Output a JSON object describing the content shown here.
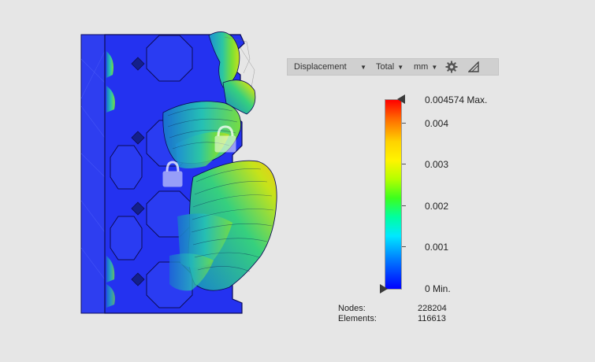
{
  "toolbar": {
    "result_type": "Displacement",
    "component": "Total",
    "unit": "mm",
    "settings_icon": "gear-icon",
    "legend_toggle_icon": "triangle-icon"
  },
  "legend": {
    "max_label": "0.004574 Max.",
    "ticks": [
      "0.004",
      "0.003",
      "0.002",
      "0.001"
    ],
    "min_label": "0 Min.",
    "colors": [
      "#ff0000",
      "#ffd200",
      "#3cff1e",
      "#00e8ff",
      "#0000ff"
    ]
  },
  "mesh": {
    "nodes_label": "Nodes:",
    "nodes_value": "228204",
    "elements_label": "Elements:",
    "elements_value": "116613"
  },
  "model": {
    "lock_icons": [
      "padlock-icon",
      "padlock-icon"
    ]
  }
}
